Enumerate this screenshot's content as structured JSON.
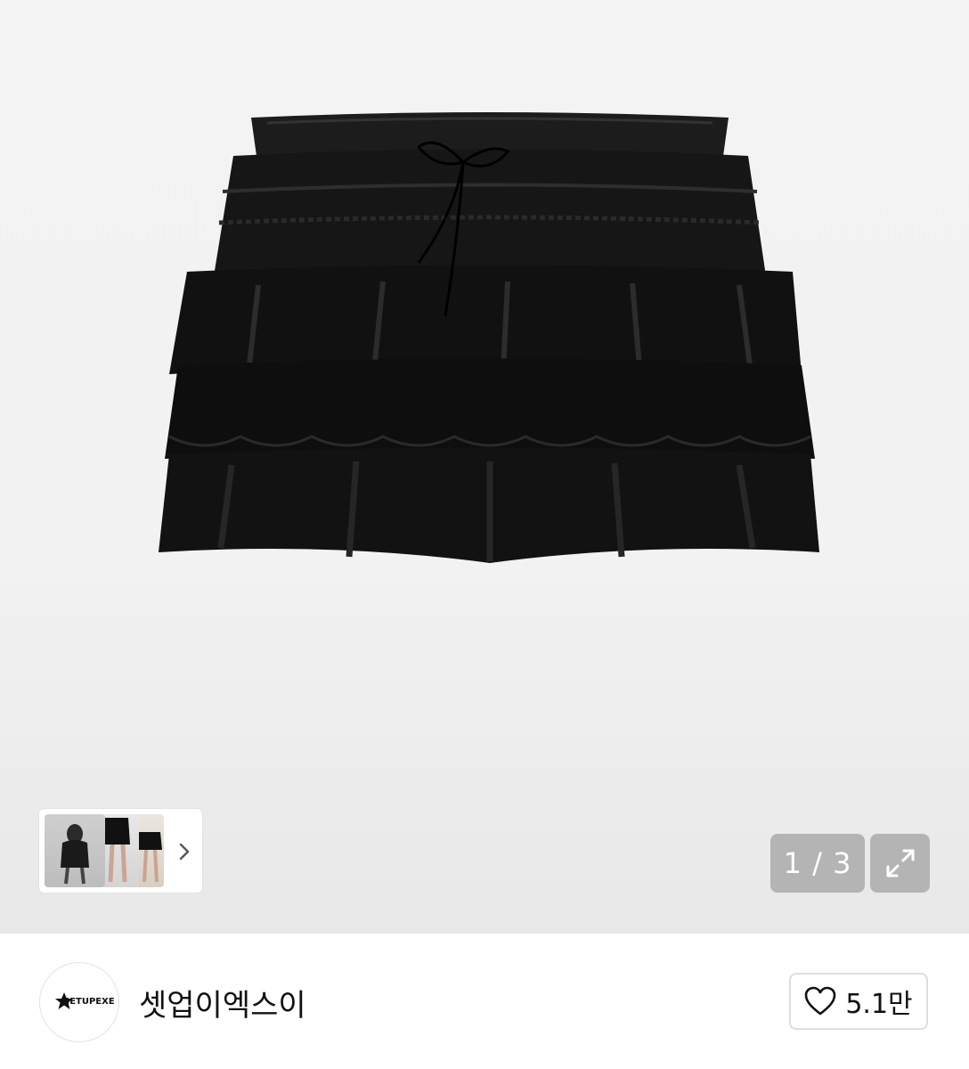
{
  "gallery": {
    "current_page": "1",
    "separator": "/",
    "total_pages": "3",
    "counter_text": "1 / 3",
    "thumbnails": [
      "thumb-model-front",
      "thumb-model-legs",
      "thumb-model-side"
    ],
    "next_icon": "chevron-right-icon",
    "expand_icon": "expand-icon"
  },
  "brand": {
    "logo_text": "SETUPEXE",
    "name": "셋업이엑스이"
  },
  "like": {
    "icon": "heart-icon",
    "count": "5.1만"
  },
  "colors": {
    "counter_bg": "#b4b4b4",
    "text": "#111111"
  }
}
